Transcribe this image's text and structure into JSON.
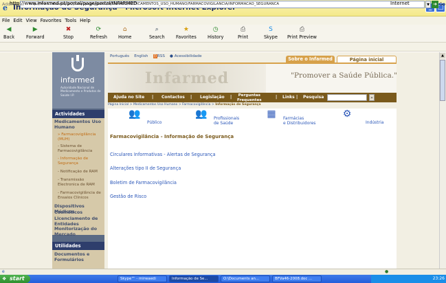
{
  "window": {
    "title": "Informação de Segurança - Microsoft Internet Explorer",
    "minimize_icon": "minimize-icon",
    "maximize_icon": "maximize-icon"
  },
  "menu": [
    "File",
    "Edit",
    "View",
    "Favorites",
    "Tools",
    "Help"
  ],
  "toolbar": {
    "back": "Back",
    "forward": "Forward",
    "stop": "Stop",
    "refresh": "Refresh",
    "home": "Home",
    "search": "Search",
    "favorites": "Favorites",
    "history": "History",
    "print": "Print",
    "skype": "Skype",
    "print_preview": "Print Preview"
  },
  "address": {
    "label": "Address",
    "url": "http://www.infarmed.pt/portal/page/portal/INFARMED/MEDICAMENTOS_USO_HUMANO/FARMACOVIGILANCIA/INFORMACAO_SEGURANCA",
    "go": "Go"
  },
  "site": {
    "logo_word": "infarmed",
    "logo_sub": "Autoridade Nacional de Medicamento e Produtos de Saúde I.P.",
    "languages": [
      "Português",
      "English",
      "RSS",
      "Acessibilidade"
    ],
    "tab_about": "Sobre o Infarmed",
    "tab_home": "Página inicial",
    "banner_mark": "Infarmed",
    "slogan": "\"Promover a Saúde Pública.\"",
    "nav": {
      "help": "Ajuda no Site",
      "contacts": "Contactos",
      "legislation": "Legislação",
      "faq_line1": "Perguntas",
      "faq_line2": "Frequentes",
      "links": "Links",
      "search": "Pesquisa",
      "search_go": "»"
    },
    "breadcrumb": "Página Inicial > Medicamentos Uso Humano > Farmacovigilância > ",
    "breadcrumb_current": "Informação de Segurança",
    "audiences": [
      {
        "label1": "Público",
        "label2": ""
      },
      {
        "label1": "Profissionais",
        "label2": "de Saúde"
      },
      {
        "label1": "Farmácias",
        "label2": "e Distribuidores"
      },
      {
        "label1": "Indústria",
        "label2": ""
      }
    ],
    "content_title": "Farmacovigilância - Informação de Segurança",
    "content_links": [
      "Circulares Informativas - Alertas de Segurança",
      "Alterações tipo II de Segurança",
      "Boletim de Farmacovigilância",
      "Gestão de Risco"
    ],
    "sidebar": {
      "head1": "Actividades",
      "main1": "Medicamentos Uso Humano",
      "sub": [
        "» Farmacovigilância (MUH)",
        "- Sistema de Farmacovigilância",
        "- Informação de Segurança",
        "- Notificação de RAM",
        "- Transmissão Electronica de RAM",
        "- Farmacovigilância de Ensaios Clínicos"
      ],
      "mains": [
        "Dispositivos Médicos",
        "Cosméticos",
        "Licenciamento de Entidades",
        "Monitorização do Mercado"
      ],
      "head2": "Utilidades",
      "util1": "Documentos e Formulários"
    }
  },
  "status": {
    "text": "http://www.infarmed.pt/portal/page/portal/INFARMED",
    "zone": "Internet"
  },
  "taskbar": {
    "start": "start",
    "tasks": [
      "Skype™ - mirwaedi",
      "Informação de Se...",
      "O:\\Documents an...",
      "BFVa46-2008.doc ..."
    ],
    "clock": "23:26"
  }
}
